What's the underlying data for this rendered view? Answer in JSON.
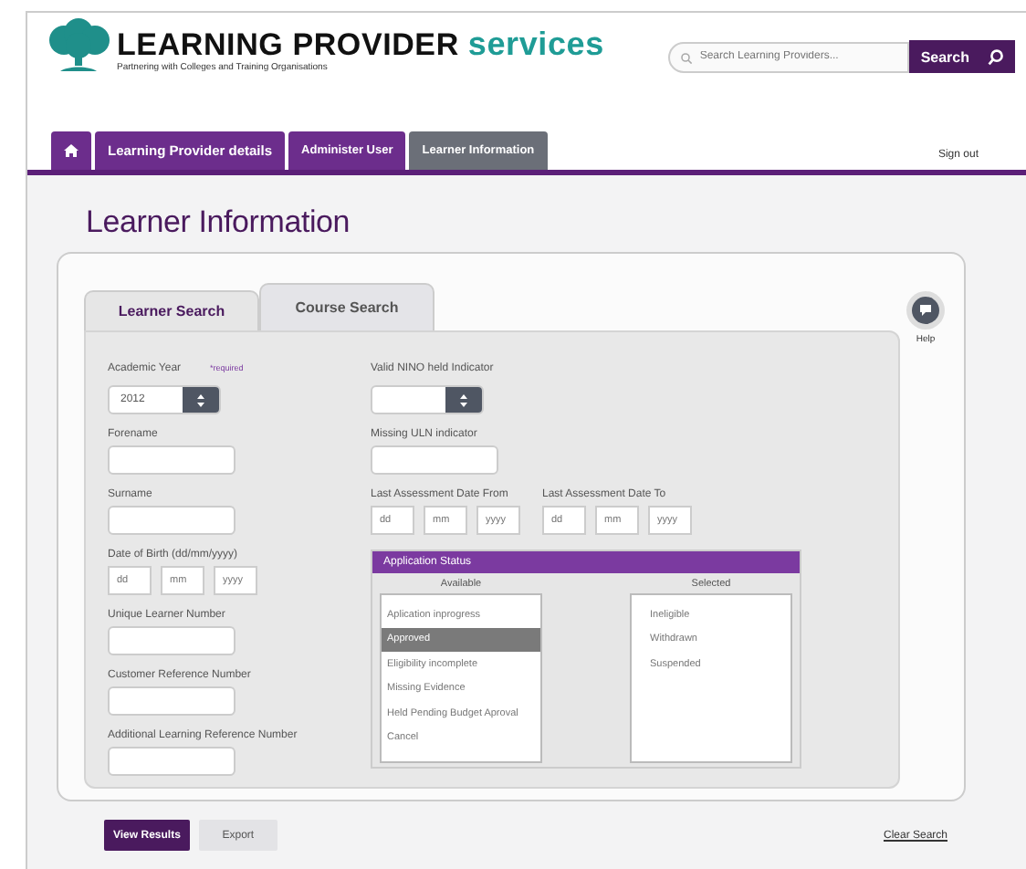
{
  "header": {
    "title": "LEARNING PROVIDER",
    "title_accent": "services",
    "tagline": "Partnering with Colleges and Training Organisations",
    "search": {
      "placeholder": "Search Learning Providers...",
      "button": "Search"
    }
  },
  "nav": {
    "tabs": [
      {
        "kind": "home",
        "selected": false
      },
      {
        "kind": "text",
        "label": "Learning Provider details",
        "selected": false
      },
      {
        "kind": "text",
        "label": "Administer User",
        "selected": false
      },
      {
        "kind": "text",
        "label": "Learner Information",
        "selected": true
      }
    ],
    "sign_out": "Sign out"
  },
  "page_title": "Learner Information",
  "help": {
    "label": "Help"
  },
  "search_tabs": [
    {
      "label": "Learner Search",
      "selected": true
    },
    {
      "label": "Course Search",
      "selected": false
    }
  ],
  "left_fields": [
    {
      "kind": "select",
      "label": "Academic Year",
      "note": "*required",
      "value": "2012"
    },
    {
      "kind": "text",
      "label": "Forename"
    },
    {
      "kind": "text",
      "label": "Surname"
    },
    {
      "kind": "date",
      "label": "Date of Birth (dd/mm/yyyy)",
      "placeholders": [
        "dd",
        "mm",
        "yyyy"
      ]
    },
    {
      "kind": "text",
      "label": "Unique Learner Number"
    },
    {
      "kind": "text",
      "label": "Customer Reference Number"
    },
    {
      "kind": "text",
      "label": "Additional Learning Reference Number"
    }
  ],
  "right_fields": [
    {
      "kind": "select",
      "label": "Valid NINO held Indicator"
    },
    {
      "kind": "text",
      "label": "Missing ULN indicator"
    },
    {
      "kind": "dates",
      "items": [
        {
          "label": "Last Assessment Date From",
          "placeholders": [
            "dd",
            "mm",
            "yyyy"
          ]
        },
        {
          "label": "Last Assessment Date To",
          "placeholders": [
            "dd",
            "mm",
            "yyyy"
          ]
        }
      ]
    }
  ],
  "application_status": {
    "title": "Application Status",
    "available": {
      "label": "Available",
      "items": [
        {
          "label": "Aplication inprogress",
          "selected": false
        },
        {
          "label": "Approved",
          "selected": true
        },
        {
          "label": "Eligibility incomplete",
          "selected": false
        },
        {
          "label": "Missing Evidence",
          "selected": false
        },
        {
          "label": "Held Pending Budget Aproval",
          "selected": false
        },
        {
          "label": "Cancel",
          "selected": false
        }
      ]
    },
    "selected": {
      "label": "Selected",
      "items": [
        {
          "label": "Ineligible",
          "selected": false
        },
        {
          "label": "Withdrawn",
          "selected": false
        },
        {
          "label": "Suspended",
          "selected": false
        }
      ]
    }
  },
  "buttons": [
    {
      "label": "View Results",
      "kind": "primary"
    },
    {
      "label": "Export",
      "kind": "secondary"
    }
  ],
  "clear_search": "Clear Search"
}
